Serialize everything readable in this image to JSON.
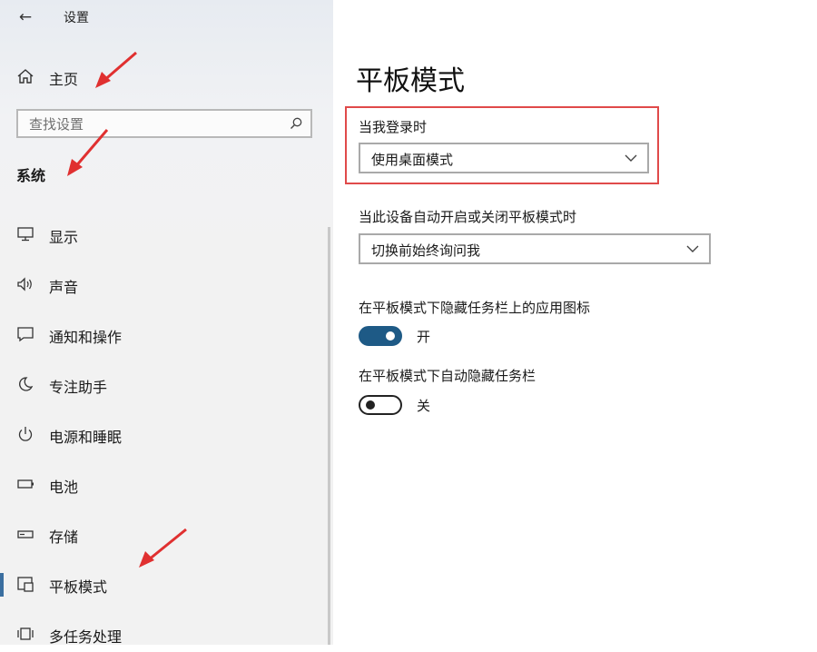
{
  "window": {
    "title": "设置",
    "back_icon": "back-arrow-icon"
  },
  "sidebar": {
    "home_label": "主页",
    "search_placeholder": "查找设置",
    "section_title": "系统",
    "items": [
      {
        "label": "显示",
        "icon": "monitor-icon"
      },
      {
        "label": "声音",
        "icon": "speaker-icon"
      },
      {
        "label": "通知和操作",
        "icon": "notification-icon"
      },
      {
        "label": "专注助手",
        "icon": "moon-icon"
      },
      {
        "label": "电源和睡眠",
        "icon": "power-icon"
      },
      {
        "label": "电池",
        "icon": "battery-icon"
      },
      {
        "label": "存储",
        "icon": "storage-icon"
      },
      {
        "label": "平板模式",
        "icon": "tablet-mode-icon",
        "active": true
      },
      {
        "label": "多任务处理",
        "icon": "multitask-icon"
      }
    ]
  },
  "main": {
    "title": "平板模式",
    "signin_label": "当我登录时",
    "signin_value": "使用桌面模式",
    "auto_switch_label": "当此设备自动开启或关闭平板模式时",
    "auto_switch_value": "切换前始终询问我",
    "hide_icons_label": "在平板模式下隐藏任务栏上的应用图标",
    "hide_icons_state": "开",
    "hide_taskbar_label": "在平板模式下自动隐藏任务栏",
    "hide_taskbar_state": "关"
  },
  "colors": {
    "accent": "#1e5a86",
    "highlight_red": "#e04a4a",
    "arrow_red": "#e03030"
  }
}
